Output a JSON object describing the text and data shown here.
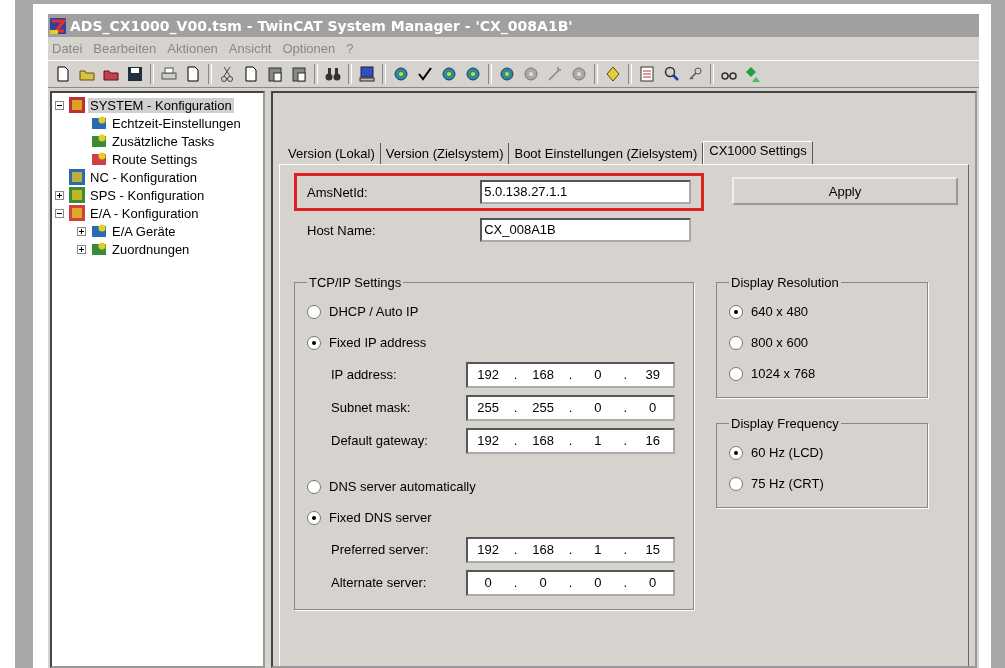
{
  "window": {
    "title": "ADS_CX1000_V00.tsm - TwinCAT System Manager - 'CX_008A1B'"
  },
  "menu": [
    "Datei",
    "Bearbeiten",
    "Aktionen",
    "Ansicht",
    "Optionen",
    "?"
  ],
  "tree": [
    {
      "label": "SYSTEM - Konfiguration",
      "expanded": true,
      "selected": true,
      "children": [
        {
          "label": "Echtzeit-Einstellungen",
          "selected": false
        },
        {
          "label": "Zusätzliche Tasks",
          "selected": false
        },
        {
          "label": "Route Settings",
          "selected": false
        }
      ]
    },
    {
      "label": "NC - Konfiguration",
      "selected": false
    },
    {
      "label": "SPS - Konfiguration",
      "expanded": false,
      "selected": false
    },
    {
      "label": "E/A - Konfiguration",
      "expanded": true,
      "selected": false,
      "children": [
        {
          "label": "E/A Geräte",
          "expanded": false,
          "selected": false
        },
        {
          "label": "Zuordnungen",
          "expanded": false,
          "selected": false
        }
      ]
    }
  ],
  "tabs": [
    {
      "label": "Version (Lokal)",
      "selected": false
    },
    {
      "label": "Version (Zielsystem)",
      "selected": false
    },
    {
      "label": "Boot Einstellungen (Zielsystem)",
      "selected": false
    },
    {
      "label": "CX1000 Settings",
      "selected": true
    }
  ],
  "fields": [
    {
      "label": "AmsNetId:",
      "value": "5.0.138.27.1.1",
      "highlighted": true
    },
    {
      "label": "Host Name:",
      "value": "CX_008A1B",
      "highlighted": false
    }
  ],
  "apply_button": "Apply",
  "tcpip": {
    "title": "TCP/IP Settings",
    "ip_mode": [
      {
        "label": "DHCP / Auto IP",
        "selected": false
      },
      {
        "label": "Fixed IP address",
        "selected": true
      }
    ],
    "ip_fields": [
      {
        "label": "IP address:",
        "octets": [
          "192",
          "168",
          "0",
          "39"
        ],
        "separator": "."
      },
      {
        "label": "Subnet mask:",
        "octets": [
          "255",
          "255",
          "0",
          "0"
        ],
        "separator": "."
      },
      {
        "label": "Default gateway:",
        "octets": [
          "192",
          "168",
          "1",
          "16"
        ],
        "separator": "."
      }
    ],
    "dns_mode": [
      {
        "label": "DNS server automatically",
        "selected": false
      },
      {
        "label": "Fixed DNS server",
        "selected": true
      }
    ],
    "dns_fields": [
      {
        "label": "Preferred server:",
        "octets": [
          "192",
          "168",
          "1",
          "15"
        ],
        "separator": "."
      },
      {
        "label": "Alternate server:",
        "octets": [
          "0",
          "0",
          "0",
          "0"
        ],
        "separator": "."
      }
    ]
  },
  "resolution": {
    "title": "Display Resolution",
    "options": [
      {
        "label": "640 x 480",
        "selected": true
      },
      {
        "label": "800 x 600",
        "selected": false
      },
      {
        "label": "1024 x 768",
        "selected": false
      }
    ]
  },
  "frequency": {
    "title": "Display Frequency",
    "options": [
      {
        "label": "60 Hz (LCD)",
        "selected": true
      },
      {
        "label": "75 Hz (CRT)",
        "selected": false
      }
    ]
  }
}
